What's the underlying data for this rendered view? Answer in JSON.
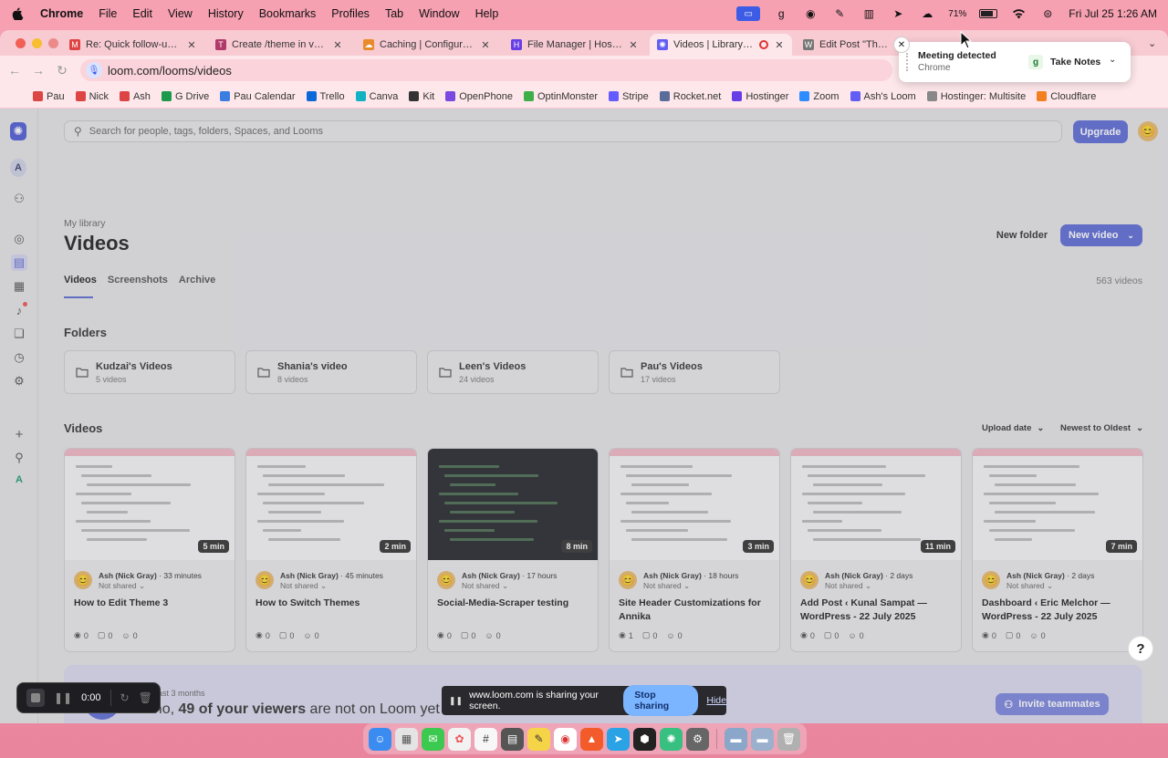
{
  "menubar": {
    "app": "Chrome",
    "items": [
      "File",
      "Edit",
      "View",
      "History",
      "Bookmarks",
      "Profiles",
      "Tab",
      "Window",
      "Help"
    ],
    "battery": "71%",
    "clock": "Fri Jul 25  1:26 AM"
  },
  "tabs": [
    {
      "title": "Re: Quick follow-up re: y",
      "color": "#d44"
    },
    {
      "title": "Create /theme in vs3.net",
      "color": "#b03a6a"
    },
    {
      "title": "Caching | Configuration |",
      "color": "#e98a2a"
    },
    {
      "title": "File Manager | Hostinger",
      "color": "#673de6"
    },
    {
      "title": "Videos | Library | Loo",
      "color": "#625df5"
    },
    {
      "title": "Edit Post \"Themes\"",
      "color": "#777"
    }
  ],
  "address": {
    "url": "loom.com/looms/videos"
  },
  "bookmarks": [
    {
      "label": "Pau",
      "color": "#d44"
    },
    {
      "label": "Nick",
      "color": "#d44"
    },
    {
      "label": "Ash",
      "color": "#d44"
    },
    {
      "label": "G Drive",
      "color": "#1a9a4a"
    },
    {
      "label": "Pau Calendar",
      "color": "#3b7de0"
    },
    {
      "label": "Trello",
      "color": "#0b68d9"
    },
    {
      "label": "Canva",
      "color": "#12b2c2"
    },
    {
      "label": "Kit",
      "color": "#333"
    },
    {
      "label": "OpenPhone",
      "color": "#7a4ae0"
    },
    {
      "label": "OptinMonster",
      "color": "#3fae49"
    },
    {
      "label": "Stripe",
      "color": "#635bff"
    },
    {
      "label": "Rocket.net",
      "color": "#5a6d9a"
    },
    {
      "label": "Hostinger",
      "color": "#673de6"
    },
    {
      "label": "Zoom",
      "color": "#2d8cff"
    },
    {
      "label": "Ash's Loom",
      "color": "#625df5"
    },
    {
      "label": "Hostinger: Multisite",
      "color": "#888"
    },
    {
      "label": "Cloudflare",
      "color": "#f38020"
    }
  ],
  "popup": {
    "title": "Meeting detected",
    "subtitle": "Chrome",
    "action": "Take Notes"
  },
  "page": {
    "search_placeholder": "Search for people, tags, folders, Spaces, and Looms",
    "upgrade": "Upgrade",
    "breadcrumb": "My library",
    "title": "Videos",
    "new_folder": "New folder",
    "new_video": "New video",
    "subtabs": [
      "Videos",
      "Screenshots",
      "Archive"
    ],
    "video_count": "563 videos",
    "folders_heading": "Folders",
    "videos_heading": "Videos",
    "sort_upload": "Upload date",
    "sort_order": "Newest to Oldest"
  },
  "folders": [
    {
      "name": "Kudzai's Videos",
      "count": "5 videos"
    },
    {
      "name": "Shania's video",
      "count": "8 videos"
    },
    {
      "name": "Leen's Videos",
      "count": "24 videos"
    },
    {
      "name": "Pau's Videos",
      "count": "17 videos"
    }
  ],
  "videos": [
    {
      "duration": "5 min",
      "author": "Ash (Nick Gray)",
      "time": "33 minutes",
      "share": "Not shared",
      "title": "How to Edit Theme 3",
      "views": "0",
      "comments": "0",
      "reactions": "0",
      "dark": false
    },
    {
      "duration": "2 min",
      "author": "Ash (Nick Gray)",
      "time": "45 minutes",
      "share": "Not shared",
      "title": "How to Switch Themes",
      "views": "0",
      "comments": "0",
      "reactions": "0",
      "dark": false
    },
    {
      "duration": "8 min",
      "author": "Ash (Nick Gray)",
      "time": "17 hours",
      "share": "Not shared",
      "title": "Social-Media-Scraper testing",
      "views": "0",
      "comments": "0",
      "reactions": "0",
      "dark": true
    },
    {
      "duration": "3 min",
      "author": "Ash (Nick Gray)",
      "time": "18 hours",
      "share": "Not shared",
      "title": "Site Header Customizations for Annika",
      "views": "1",
      "comments": "0",
      "reactions": "0",
      "dark": false
    },
    {
      "duration": "11 min",
      "author": "Ash (Nick Gray)",
      "time": "2 days",
      "share": "Not shared",
      "title": "Add Post ‹ Kunal Sampat — WordPress - 22 July 2025",
      "views": "0",
      "comments": "0",
      "reactions": "0",
      "dark": false
    },
    {
      "duration": "7 min",
      "author": "Ash (Nick Gray)",
      "time": "2 days",
      "share": "Not shared",
      "title": "Dashboard ‹ Eric Melchor — WordPress - 22 July 2025",
      "views": "0",
      "comments": "0",
      "reactions": "0",
      "dark": false
    }
  ],
  "banner": {
    "small": "In the past 3 months",
    "prefix": "Oh no, ",
    "bold": "49 of your viewers",
    "suffix": " are not on Loom yet",
    "invite": "Invite teammates"
  },
  "recorder": {
    "time": "0:00"
  },
  "sharebar": {
    "message": "www.loom.com is sharing your screen.",
    "stop": "Stop sharing",
    "hide": "Hide"
  }
}
